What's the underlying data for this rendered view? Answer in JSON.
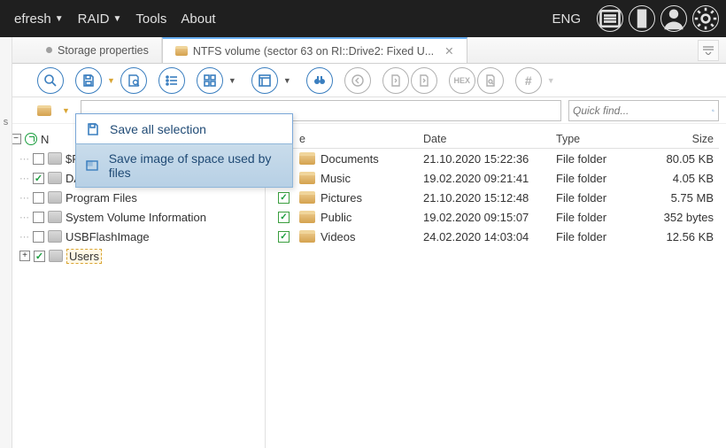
{
  "menu": {
    "refresh": "efresh",
    "raid": "RAID",
    "tools": "Tools",
    "about": "About",
    "lang": "ENG"
  },
  "tabs": {
    "storage": "Storage properties",
    "volume": "NTFS volume (sector 63 on RI::Drive2: Fixed U..."
  },
  "dropdown": {
    "save_all": "Save all selection",
    "save_image": "Save image of space used by files"
  },
  "search": {
    "placeholder": "Quick find..."
  },
  "tree": {
    "root": "N",
    "items": [
      {
        "label": "$RECYCLE.BIN",
        "checked": false
      },
      {
        "label": "DATA",
        "checked": true
      },
      {
        "label": "Program Files",
        "checked": false
      },
      {
        "label": "System Volume Information",
        "checked": false
      },
      {
        "label": "USBFlashImage",
        "checked": false
      },
      {
        "label": "Users",
        "checked": true,
        "selected": true,
        "expandable": true
      }
    ]
  },
  "list": {
    "headers": {
      "name": "e",
      "date": "Date",
      "type": "Type",
      "size": "Size"
    },
    "rows": [
      {
        "name": "Documents",
        "date": "21.10.2020 15:22:36",
        "type": "File folder",
        "size": "80.05 KB"
      },
      {
        "name": "Music",
        "date": "19.02.2020 09:21:41",
        "type": "File folder",
        "size": "4.05 KB"
      },
      {
        "name": "Pictures",
        "date": "21.10.2020 15:12:48",
        "type": "File folder",
        "size": "5.75 MB"
      },
      {
        "name": "Public",
        "date": "19.02.2020 09:15:07",
        "type": "File folder",
        "size": "352 bytes"
      },
      {
        "name": "Videos",
        "date": "24.02.2020 14:03:04",
        "type": "File folder",
        "size": "12.56 KB"
      }
    ]
  },
  "left_strip": {
    "label": "s"
  }
}
